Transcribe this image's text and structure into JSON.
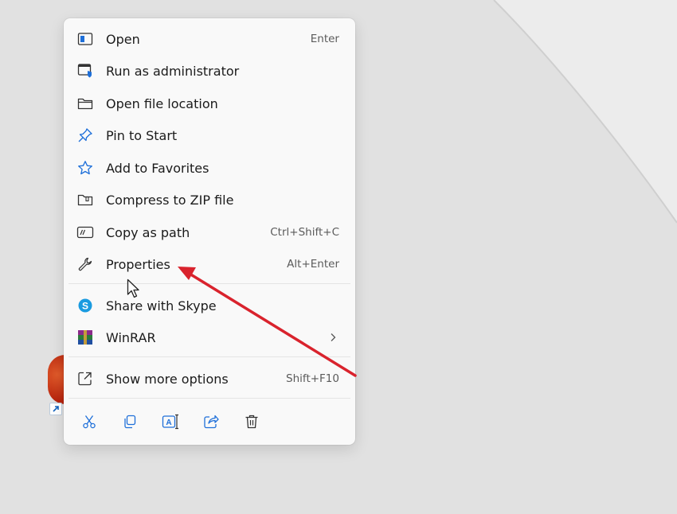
{
  "menu": {
    "items": [
      {
        "label": "Open",
        "shortcut": "Enter",
        "icon": "open-window-icon"
      },
      {
        "label": "Run as administrator",
        "shortcut": "",
        "icon": "admin-shield-icon"
      },
      {
        "label": "Open file location",
        "shortcut": "",
        "icon": "folder-icon"
      },
      {
        "label": "Pin to Start",
        "shortcut": "",
        "icon": "pin-icon"
      },
      {
        "label": "Add to Favorites",
        "shortcut": "",
        "icon": "star-icon"
      },
      {
        "label": "Compress to ZIP file",
        "shortcut": "",
        "icon": "zip-icon"
      },
      {
        "label": "Copy as path",
        "shortcut": "Ctrl+Shift+C",
        "icon": "copy-path-icon"
      },
      {
        "label": "Properties",
        "shortcut": "Alt+Enter",
        "icon": "wrench-icon"
      }
    ],
    "apps": [
      {
        "label": "Share with Skype",
        "icon": "skype-icon"
      },
      {
        "label": "WinRAR",
        "icon": "winrar-icon"
      }
    ],
    "more": {
      "label": "Show more options",
      "shortcut": "Shift+F10",
      "icon": "show-more-icon"
    },
    "bottom_actions": [
      "cut-icon",
      "copy-icon",
      "rename-icon",
      "share-icon",
      "delete-icon"
    ]
  },
  "colors": {
    "accent": "#0067c0",
    "annotation_arrow": "#d9232d",
    "menu_bg": "#f9f9f9",
    "desktop_bg": "#e1e1e1"
  }
}
